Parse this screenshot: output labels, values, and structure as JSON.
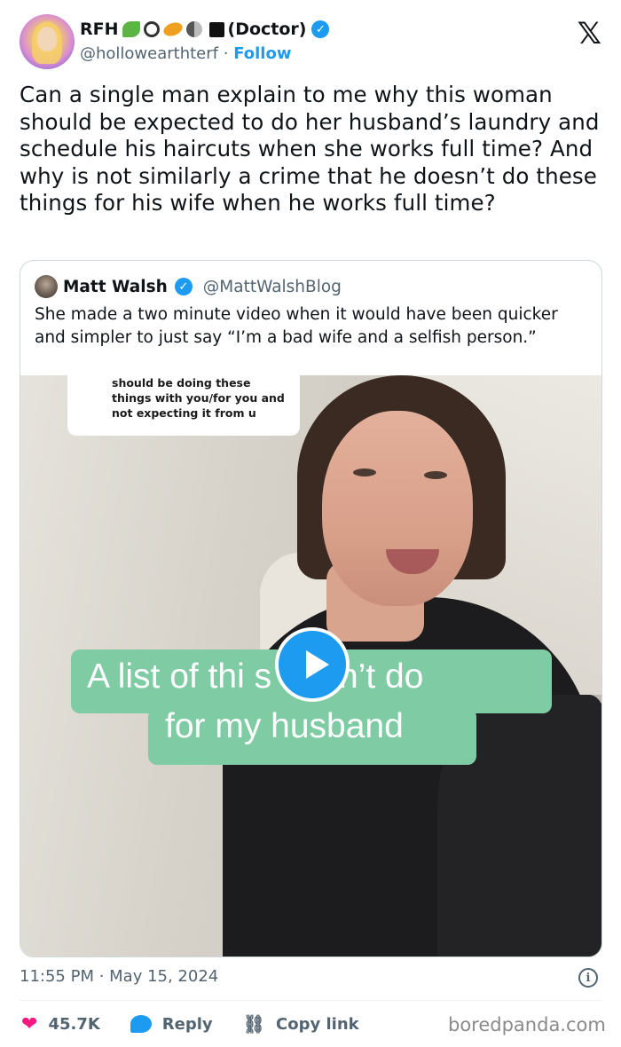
{
  "author": {
    "display_name": "RFH",
    "name_suffix": "(Doctor)",
    "handle": "@hollowearthterf",
    "follow_label": "Follow",
    "separator": "·"
  },
  "tweet": {
    "text": "Can a single man explain to me why this woman should be expected to do her husband’s laundry and schedule his haircuts when she works full time? And why is not similarly a crime that he doesn’t do these things for his wife when he works full time?",
    "timestamp": "11:55 PM · May 15, 2024"
  },
  "quoted": {
    "name": "Matt Walsh",
    "handle": "@MattWalshBlog",
    "text": "She made a two minute video when it would have been quicker and simpler to just say “I’m a bad wife and a selfish person.”",
    "video": {
      "caption_bubble": "should be doing these things with you/for you and not expecting it from u",
      "overlay_line1": "A list of thi   s I don’t do",
      "overlay_line2": "for my husband",
      "overlay_color": "#7ecba4"
    }
  },
  "actions": {
    "like_count": "45.7K",
    "reply_label": "Reply",
    "copy_link_label": "Copy link"
  },
  "watermark": "boredpanda.com",
  "icons": {
    "platform": "x-logo",
    "verified": "verified-badge-icon",
    "like": "heart-icon",
    "reply": "reply-bubble-icon",
    "copy": "link-icon",
    "info": "info-icon",
    "play": "play-icon"
  },
  "colors": {
    "accent": "#1d9bf0",
    "like": "#f91880",
    "secondary_text": "#536471"
  }
}
